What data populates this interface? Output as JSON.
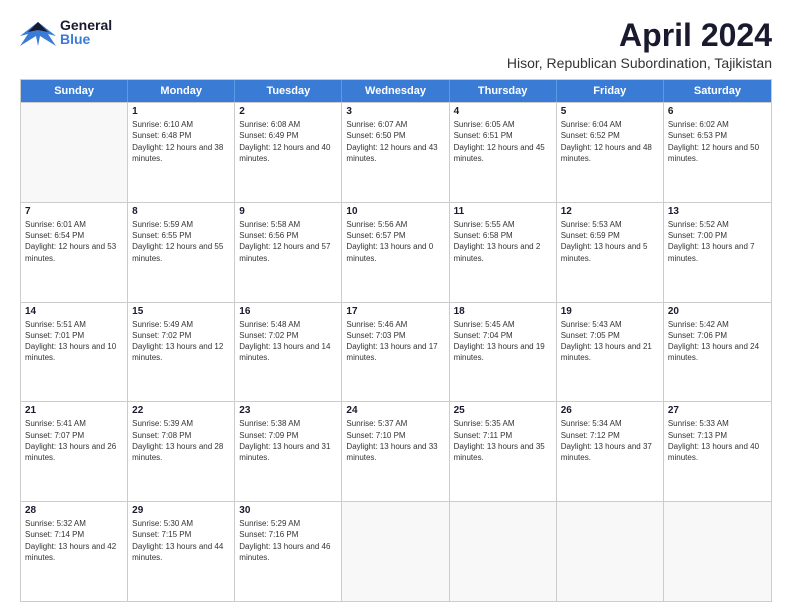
{
  "logo": {
    "general": "General",
    "blue": "Blue"
  },
  "header": {
    "month_year": "April 2024",
    "location": "Hisor, Republican Subordination, Tajikistan"
  },
  "days_of_week": [
    "Sunday",
    "Monday",
    "Tuesday",
    "Wednesday",
    "Thursday",
    "Friday",
    "Saturday"
  ],
  "weeks": [
    [
      {
        "day": "",
        "empty": true
      },
      {
        "day": "1",
        "sunrise": "Sunrise: 6:10 AM",
        "sunset": "Sunset: 6:48 PM",
        "daylight": "Daylight: 12 hours and 38 minutes."
      },
      {
        "day": "2",
        "sunrise": "Sunrise: 6:08 AM",
        "sunset": "Sunset: 6:49 PM",
        "daylight": "Daylight: 12 hours and 40 minutes."
      },
      {
        "day": "3",
        "sunrise": "Sunrise: 6:07 AM",
        "sunset": "Sunset: 6:50 PM",
        "daylight": "Daylight: 12 hours and 43 minutes."
      },
      {
        "day": "4",
        "sunrise": "Sunrise: 6:05 AM",
        "sunset": "Sunset: 6:51 PM",
        "daylight": "Daylight: 12 hours and 45 minutes."
      },
      {
        "day": "5",
        "sunrise": "Sunrise: 6:04 AM",
        "sunset": "Sunset: 6:52 PM",
        "daylight": "Daylight: 12 hours and 48 minutes."
      },
      {
        "day": "6",
        "sunrise": "Sunrise: 6:02 AM",
        "sunset": "Sunset: 6:53 PM",
        "daylight": "Daylight: 12 hours and 50 minutes."
      }
    ],
    [
      {
        "day": "7",
        "sunrise": "Sunrise: 6:01 AM",
        "sunset": "Sunset: 6:54 PM",
        "daylight": "Daylight: 12 hours and 53 minutes."
      },
      {
        "day": "8",
        "sunrise": "Sunrise: 5:59 AM",
        "sunset": "Sunset: 6:55 PM",
        "daylight": "Daylight: 12 hours and 55 minutes."
      },
      {
        "day": "9",
        "sunrise": "Sunrise: 5:58 AM",
        "sunset": "Sunset: 6:56 PM",
        "daylight": "Daylight: 12 hours and 57 minutes."
      },
      {
        "day": "10",
        "sunrise": "Sunrise: 5:56 AM",
        "sunset": "Sunset: 6:57 PM",
        "daylight": "Daylight: 13 hours and 0 minutes."
      },
      {
        "day": "11",
        "sunrise": "Sunrise: 5:55 AM",
        "sunset": "Sunset: 6:58 PM",
        "daylight": "Daylight: 13 hours and 2 minutes."
      },
      {
        "day": "12",
        "sunrise": "Sunrise: 5:53 AM",
        "sunset": "Sunset: 6:59 PM",
        "daylight": "Daylight: 13 hours and 5 minutes."
      },
      {
        "day": "13",
        "sunrise": "Sunrise: 5:52 AM",
        "sunset": "Sunset: 7:00 PM",
        "daylight": "Daylight: 13 hours and 7 minutes."
      }
    ],
    [
      {
        "day": "14",
        "sunrise": "Sunrise: 5:51 AM",
        "sunset": "Sunset: 7:01 PM",
        "daylight": "Daylight: 13 hours and 10 minutes."
      },
      {
        "day": "15",
        "sunrise": "Sunrise: 5:49 AM",
        "sunset": "Sunset: 7:02 PM",
        "daylight": "Daylight: 13 hours and 12 minutes."
      },
      {
        "day": "16",
        "sunrise": "Sunrise: 5:48 AM",
        "sunset": "Sunset: 7:02 PM",
        "daylight": "Daylight: 13 hours and 14 minutes."
      },
      {
        "day": "17",
        "sunrise": "Sunrise: 5:46 AM",
        "sunset": "Sunset: 7:03 PM",
        "daylight": "Daylight: 13 hours and 17 minutes."
      },
      {
        "day": "18",
        "sunrise": "Sunrise: 5:45 AM",
        "sunset": "Sunset: 7:04 PM",
        "daylight": "Daylight: 13 hours and 19 minutes."
      },
      {
        "day": "19",
        "sunrise": "Sunrise: 5:43 AM",
        "sunset": "Sunset: 7:05 PM",
        "daylight": "Daylight: 13 hours and 21 minutes."
      },
      {
        "day": "20",
        "sunrise": "Sunrise: 5:42 AM",
        "sunset": "Sunset: 7:06 PM",
        "daylight": "Daylight: 13 hours and 24 minutes."
      }
    ],
    [
      {
        "day": "21",
        "sunrise": "Sunrise: 5:41 AM",
        "sunset": "Sunset: 7:07 PM",
        "daylight": "Daylight: 13 hours and 26 minutes."
      },
      {
        "day": "22",
        "sunrise": "Sunrise: 5:39 AM",
        "sunset": "Sunset: 7:08 PM",
        "daylight": "Daylight: 13 hours and 28 minutes."
      },
      {
        "day": "23",
        "sunrise": "Sunrise: 5:38 AM",
        "sunset": "Sunset: 7:09 PM",
        "daylight": "Daylight: 13 hours and 31 minutes."
      },
      {
        "day": "24",
        "sunrise": "Sunrise: 5:37 AM",
        "sunset": "Sunset: 7:10 PM",
        "daylight": "Daylight: 13 hours and 33 minutes."
      },
      {
        "day": "25",
        "sunrise": "Sunrise: 5:35 AM",
        "sunset": "Sunset: 7:11 PM",
        "daylight": "Daylight: 13 hours and 35 minutes."
      },
      {
        "day": "26",
        "sunrise": "Sunrise: 5:34 AM",
        "sunset": "Sunset: 7:12 PM",
        "daylight": "Daylight: 13 hours and 37 minutes."
      },
      {
        "day": "27",
        "sunrise": "Sunrise: 5:33 AM",
        "sunset": "Sunset: 7:13 PM",
        "daylight": "Daylight: 13 hours and 40 minutes."
      }
    ],
    [
      {
        "day": "28",
        "sunrise": "Sunrise: 5:32 AM",
        "sunset": "Sunset: 7:14 PM",
        "daylight": "Daylight: 13 hours and 42 minutes."
      },
      {
        "day": "29",
        "sunrise": "Sunrise: 5:30 AM",
        "sunset": "Sunset: 7:15 PM",
        "daylight": "Daylight: 13 hours and 44 minutes."
      },
      {
        "day": "30",
        "sunrise": "Sunrise: 5:29 AM",
        "sunset": "Sunset: 7:16 PM",
        "daylight": "Daylight: 13 hours and 46 minutes."
      },
      {
        "day": "",
        "empty": true
      },
      {
        "day": "",
        "empty": true
      },
      {
        "day": "",
        "empty": true
      },
      {
        "day": "",
        "empty": true
      }
    ]
  ]
}
